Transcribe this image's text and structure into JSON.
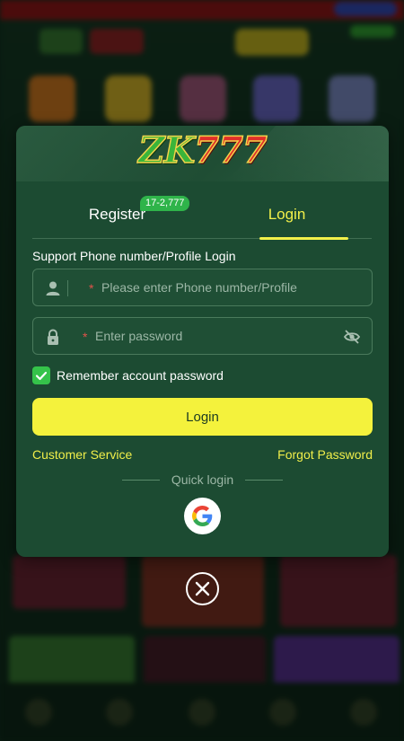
{
  "brand": {
    "logo_text_a": "ZK",
    "logo_text_b": "777"
  },
  "tabs": {
    "register": {
      "label": "Register",
      "badge": "17-2,777"
    },
    "login": {
      "label": "Login",
      "active": true
    }
  },
  "form": {
    "subtitle": "Support Phone number/Profile Login",
    "phone": {
      "placeholder": "Please enter Phone number/Profile",
      "value": "",
      "required_mark": "*",
      "icon": "user-icon"
    },
    "password": {
      "placeholder": "Enter password",
      "value": "",
      "required_mark": "*",
      "icon": "lock-icon",
      "toggle_icon": "eye-off-icon"
    },
    "remember": {
      "label": "Remember account password",
      "checked": true
    },
    "submit_label": "Login"
  },
  "links": {
    "customer_service": "Customer Service",
    "forgot_password": "Forgot Password"
  },
  "quick_login": {
    "label": "Quick login",
    "providers": [
      "google-icon"
    ]
  },
  "colors": {
    "accent": "#f4f23c",
    "modal_bg": "#1c4b32",
    "badge": "#2fb44a",
    "checkbox": "#35c34a"
  }
}
